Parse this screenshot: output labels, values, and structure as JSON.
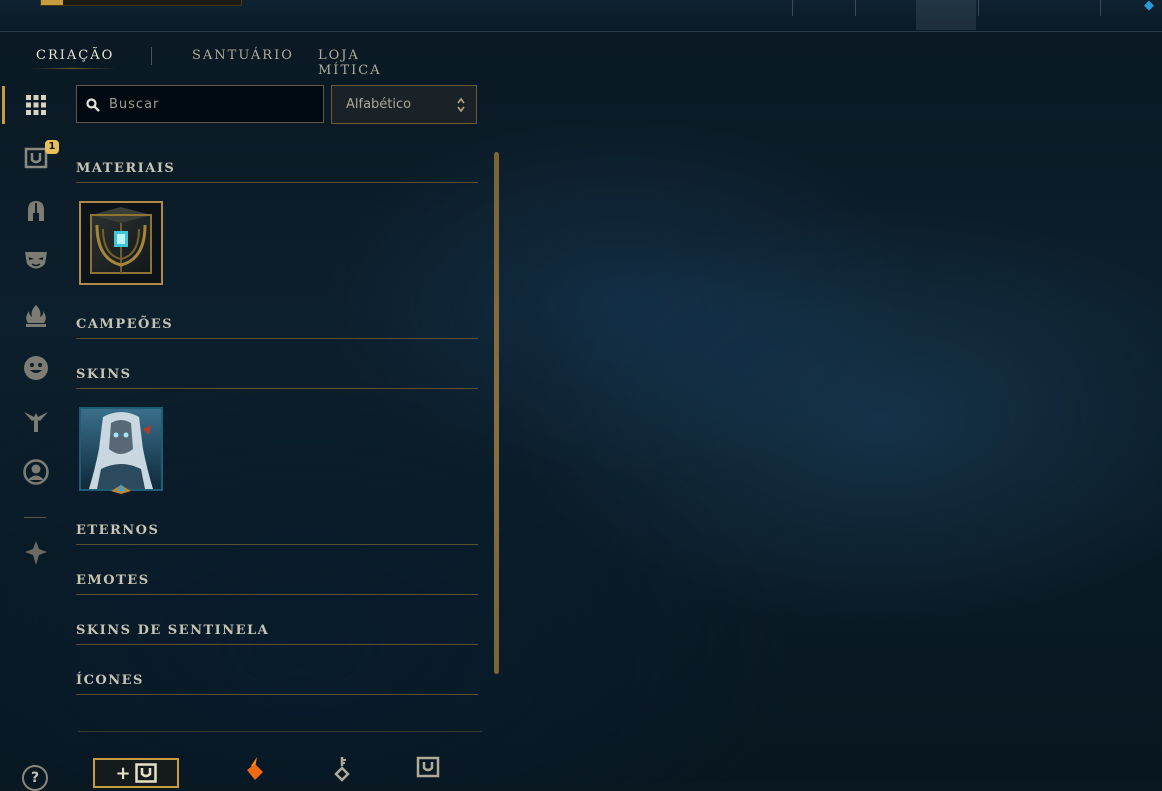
{
  "tabs": [
    {
      "label": "CRIAÇÃO",
      "active": true
    },
    {
      "label": "SANTUÁRIO",
      "active": false
    },
    {
      "label": "LOJA MÍTICA",
      "active": false
    }
  ],
  "rail": {
    "items": [
      "grid-icon",
      "chest-icon",
      "helmet-icon",
      "mask-icon",
      "flame-icon",
      "smiley-icon",
      "ward-icon",
      "profile-icon",
      "trophy-icon"
    ],
    "chest_badge": "1"
  },
  "search": {
    "placeholder": "Buscar"
  },
  "sort": {
    "value": "Alfabético"
  },
  "categories": [
    {
      "label": "MATERIAIS"
    },
    {
      "label": "CAMPEÕES"
    },
    {
      "label": "SKINS"
    },
    {
      "label": "ETERNOS"
    },
    {
      "label": "EMOTES"
    },
    {
      "label": "SKINS DE SENTINELA"
    },
    {
      "label": "ÍCONES"
    }
  ],
  "bottom": {
    "add_label": "+",
    "help_label": "?"
  },
  "colors": {
    "accent_gold": "#c89b3c",
    "badge": "#e6c05a",
    "background": "#0a1822"
  }
}
